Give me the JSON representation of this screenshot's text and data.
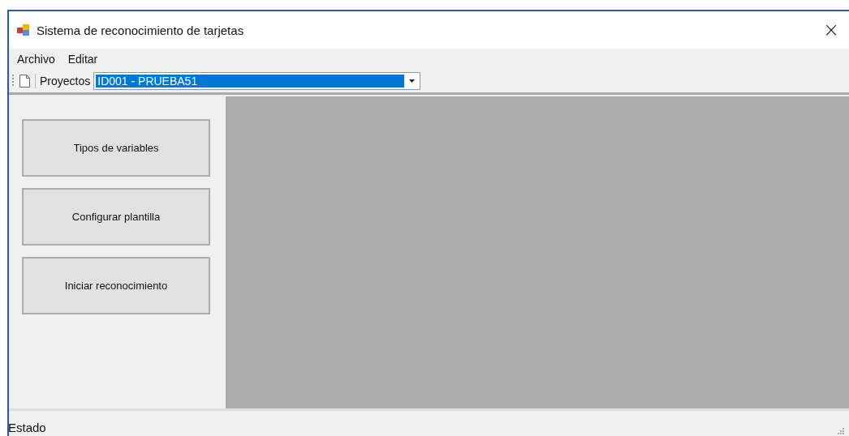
{
  "window": {
    "title": "Sistema de reconocimiento de tarjetas",
    "close": "×"
  },
  "menu": [
    {
      "label": "Archivo"
    },
    {
      "label": "Editar"
    }
  ],
  "toolbar": {
    "label": "Proyectos",
    "project": "ID001 - PRUEBA51"
  },
  "buttons": [
    {
      "label": "Tipos de variables"
    },
    {
      "label": "Configurar plantilla"
    },
    {
      "label": "Iniciar reconocimiento"
    }
  ],
  "status_bar": {
    "text": "Estado"
  }
}
